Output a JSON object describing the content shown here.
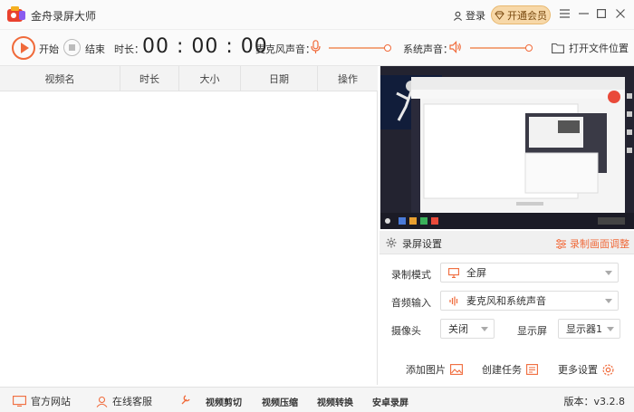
{
  "title_bar": {
    "app_title": "金舟录屏大师",
    "login_label": "登录",
    "vip_label": "开通会员",
    "menu_icon": "menu-icon",
    "minimize_icon": "minimize-icon",
    "maximize_icon": "maximize-icon",
    "close_icon": "close-icon"
  },
  "toolbar": {
    "start_label": "开始",
    "stop_label": "结束",
    "duration_label": "时长：",
    "duration_value": "00 : 00 : 00",
    "mic_label": "麦克风声音：",
    "system_label": "系统声音：",
    "open_folder_label": "打开文件位置",
    "mic_volume": 1.0,
    "system_volume": 1.0,
    "accent_color": "#f06a3a"
  },
  "file_list": {
    "columns": [
      "视频名",
      "时长",
      "大小",
      "日期",
      "操作"
    ],
    "rows": []
  },
  "settings": {
    "header_label": "录屏设置",
    "adjust_label": "录制画面调整",
    "mode_label": "录制模式",
    "mode_value": "全屏",
    "audio_label": "音频输入",
    "audio_value": "麦克风和系统声音",
    "camera_label": "摄像头",
    "camera_value": "关闭",
    "display_label": "显示屏",
    "display_value": "显示器1",
    "add_image_label": "添加图片",
    "create_task_label": "创建任务",
    "more_settings_label": "更多设置"
  },
  "bottom_bar": {
    "website_label": "官方网站",
    "service_label": "在线客服",
    "video_cut_label": "视频剪切",
    "video_compress_label": "视频压缩",
    "video_convert_label": "视频转换",
    "android_record_label": "安卓录屏",
    "version_label": "版本：v3.2.8"
  }
}
